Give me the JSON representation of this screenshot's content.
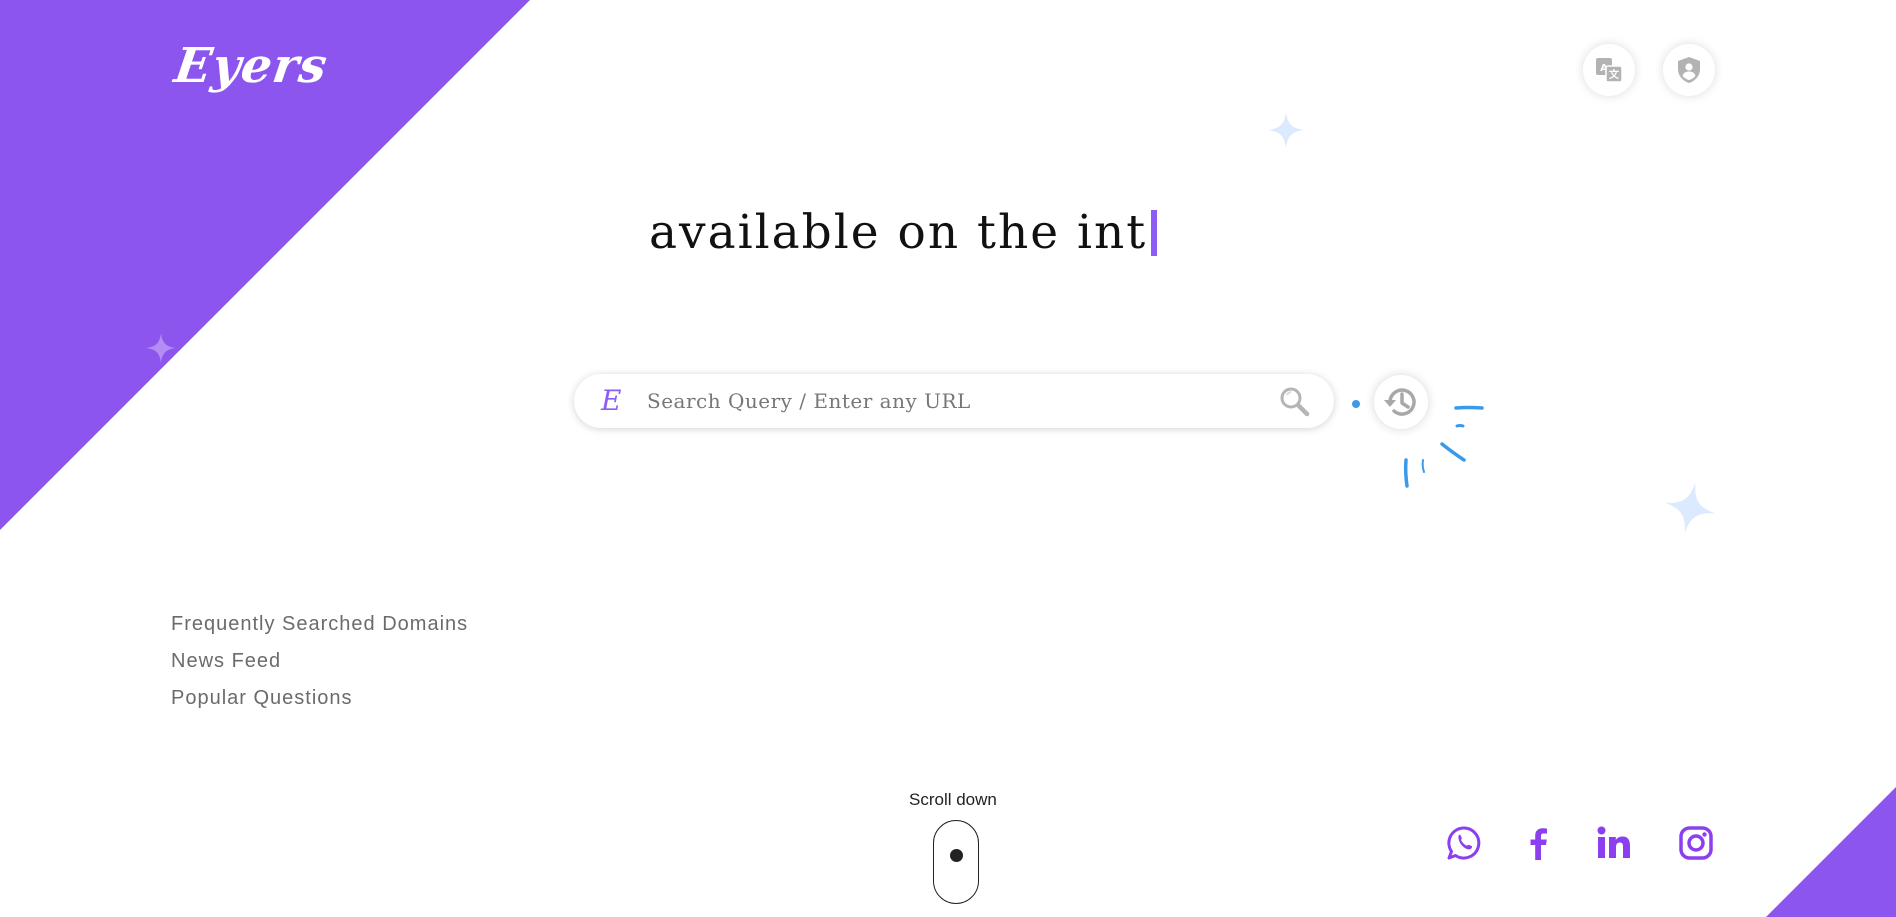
{
  "brand": {
    "logo_text": "Eyers",
    "search_mark": "E",
    "accent_color": "#8b5cf6",
    "sparkle_color": "#dbeafe",
    "burst_color": "#3b9ae8"
  },
  "header": {
    "buttons": [
      {
        "name": "translate-button",
        "icon": "translate-icon"
      },
      {
        "name": "account-button",
        "icon": "user-shield-icon"
      }
    ]
  },
  "hero": {
    "typed_text": "available on the int"
  },
  "search": {
    "placeholder": "Search Query / Enter any URL",
    "value": "",
    "search_icon": "magnifier-icon",
    "history_icon": "history-icon"
  },
  "links": [
    {
      "label": "Frequently Searched Domains"
    },
    {
      "label": "News Feed"
    },
    {
      "label": "Popular Questions"
    }
  ],
  "scroll": {
    "label": "Scroll down"
  },
  "social": [
    {
      "name": "whatsapp",
      "icon": "whatsapp-icon"
    },
    {
      "name": "facebook",
      "icon": "facebook-icon"
    },
    {
      "name": "linkedin",
      "icon": "linkedin-icon"
    },
    {
      "name": "instagram",
      "icon": "instagram-icon"
    }
  ]
}
